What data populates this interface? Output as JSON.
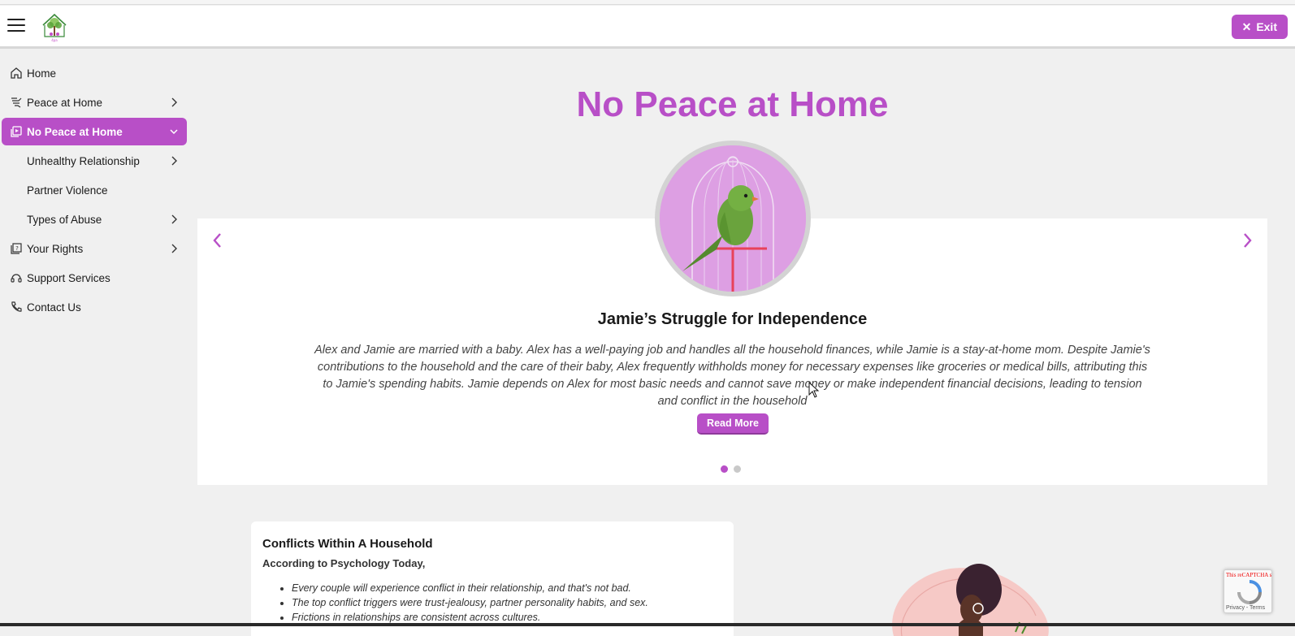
{
  "header": {
    "exit_label": "Exit"
  },
  "sidebar": {
    "items": [
      {
        "label": "Home",
        "icon": "home-icon"
      },
      {
        "label": "Peace at Home",
        "icon": "dove-icon"
      },
      {
        "label": "No Peace at Home",
        "icon": "media-icon",
        "active": true
      },
      {
        "label": "Unhealthy Relationship"
      },
      {
        "label": "Partner Violence"
      },
      {
        "label": "Types of Abuse"
      },
      {
        "label": "Your Rights",
        "icon": "law-book-icon"
      },
      {
        "label": "Support Services",
        "icon": "headset-icon"
      },
      {
        "label": "Contact Us",
        "icon": "phone-icon"
      }
    ]
  },
  "main": {
    "title": "No Peace at Home",
    "slide": {
      "title": "Jamie’s Struggle for Independence",
      "body": "Alex and Jamie are married with a baby. Alex has a well-paying job and handles all the household finances, while Jamie is a stay-at-home mom. Despite Jamie's contributions to the household and the care of their baby, Alex frequently withholds money for necessary expenses like groceries or medical bills, attributing this to Jamie's spending habits. Jamie depends on Alex for most basic needs and cannot save money or make independent financial decisions, leading to tension and conflict in the household",
      "read_more": "Read More",
      "current_slide": 1,
      "total_slides": 2
    },
    "card": {
      "title": "Conflicts Within A Household",
      "subtitle": "According to Psychology Today,",
      "bullets": [
        "Every couple will experience conflict in their relationship, and that's not bad.",
        "The top conflict triggers were trust-jealousy, partner personality habits, and sex.",
        "Frictions in relationships are consistent across cultures."
      ]
    }
  },
  "recaptcha": {
    "error_text": "This reCAPTCHA site ... ou a",
    "terms": "Privacy - Terms"
  },
  "colors": {
    "accent": "#b84fc7",
    "background": "#f0f0f0",
    "circle_fill": "#dd9fe3"
  }
}
